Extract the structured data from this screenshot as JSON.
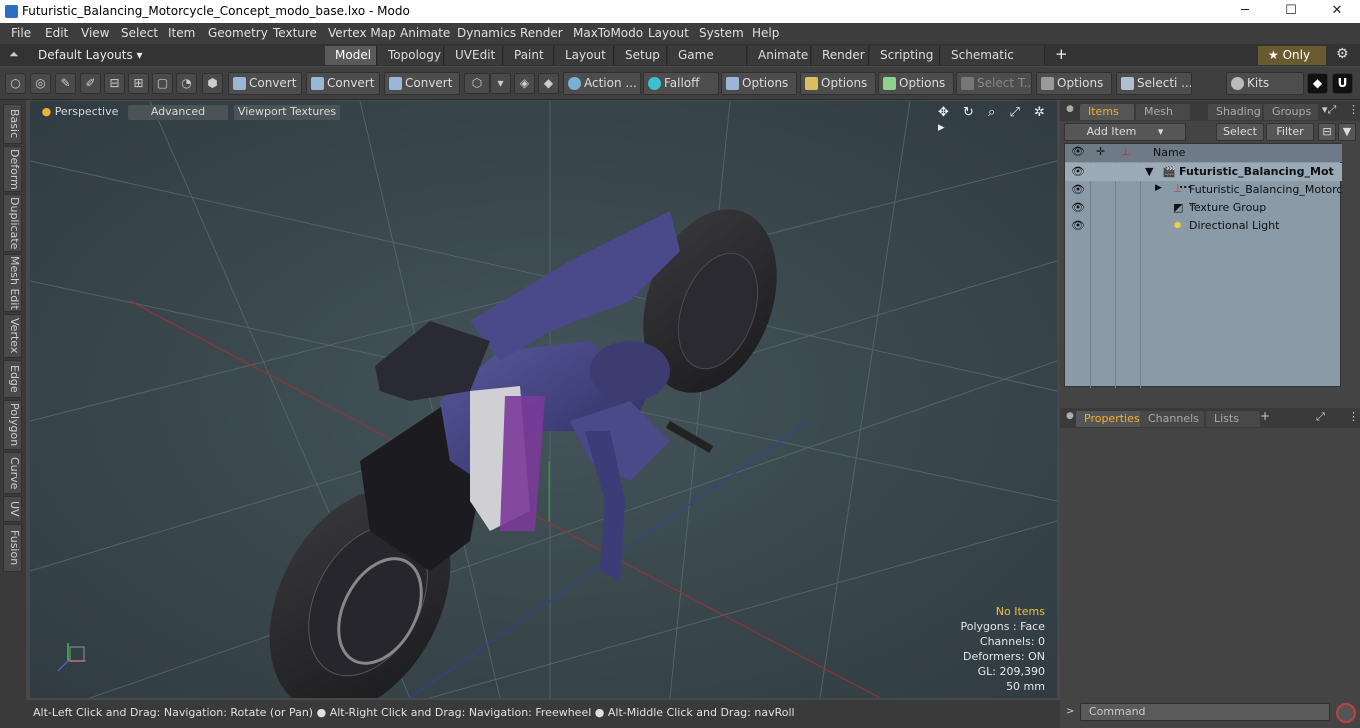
{
  "window": {
    "title": "Futuristic_Balancing_Motorcycle_Concept_modo_base.lxo - Modo",
    "minimize": "─",
    "maximize": "☐",
    "close": "✕"
  },
  "menu": [
    "File",
    "Edit",
    "View",
    "Select",
    "Item",
    "Geometry",
    "Texture",
    "Vertex Map",
    "Animate",
    "Dynamics",
    "Render",
    "MaxToModo",
    "Layout",
    "System",
    "Help"
  ],
  "layouts_label": "Default Layouts ▾",
  "tabs": [
    "Model",
    "Topology",
    "UVEdit",
    "Paint",
    "Layout",
    "Setup",
    "Game Tools",
    "Animate",
    "Render",
    "Scripting",
    "Schematic Fusion"
  ],
  "active_tab": "Model",
  "add_tab": "+",
  "only_label": "★  Only",
  "toolbar": {
    "convert1": "Convert",
    "convert2": "Convert",
    "convert3": "Convert",
    "action": "Action  ...",
    "falloff": "Falloff",
    "options1": "Options",
    "options2": "Options",
    "options3": "Options",
    "select_t": "Select T...",
    "options4": "Options",
    "selecti": "Selecti ...",
    "kits": "Kits"
  },
  "left_tabs": [
    "Basic",
    "Deform",
    "Duplicate",
    "Mesh Edit",
    "Vertex",
    "Edge",
    "Polygon",
    "Curve",
    "UV",
    "Fusion"
  ],
  "viewport": {
    "perspective": "Perspective",
    "advanced": "Advanced",
    "textures": "Viewport Textures",
    "icons": "✥ ↻ ⌕ ⤢ ✲ ▸",
    "info": {
      "no_items": "No Items",
      "polygons": "Polygons : Face",
      "channels": "Channels: 0",
      "deformers": "Deformers: ON",
      "gl": "GL: 209,390",
      "focal": "50 mm"
    }
  },
  "status": "Alt-Left Click and Drag: Navigation: Rotate (or Pan) ● Alt-Right Click and Drag: Navigation: Freewheel ● Alt-Middle Click and Drag: navRoll",
  "items_panel": {
    "tabs": [
      "Items",
      "Mesh ...",
      "Shading",
      "Groups"
    ],
    "add_item": "Add Item",
    "select": "Select",
    "filter": "Filter",
    "name_header": "Name",
    "rows": [
      "Futuristic_Balancing_Mot ...",
      "Futuristic_Balancing_Motorc ...",
      "Texture Group",
      "Directional Light"
    ]
  },
  "props_panel": {
    "tabs": [
      "Properties",
      "Channels",
      "Lists"
    ],
    "add": "+"
  },
  "command_placeholder": "Command",
  "colors": {
    "accent": "#f0b030",
    "viewport_bg": "#3b4a50",
    "bike_purple": "#3c3c78"
  }
}
